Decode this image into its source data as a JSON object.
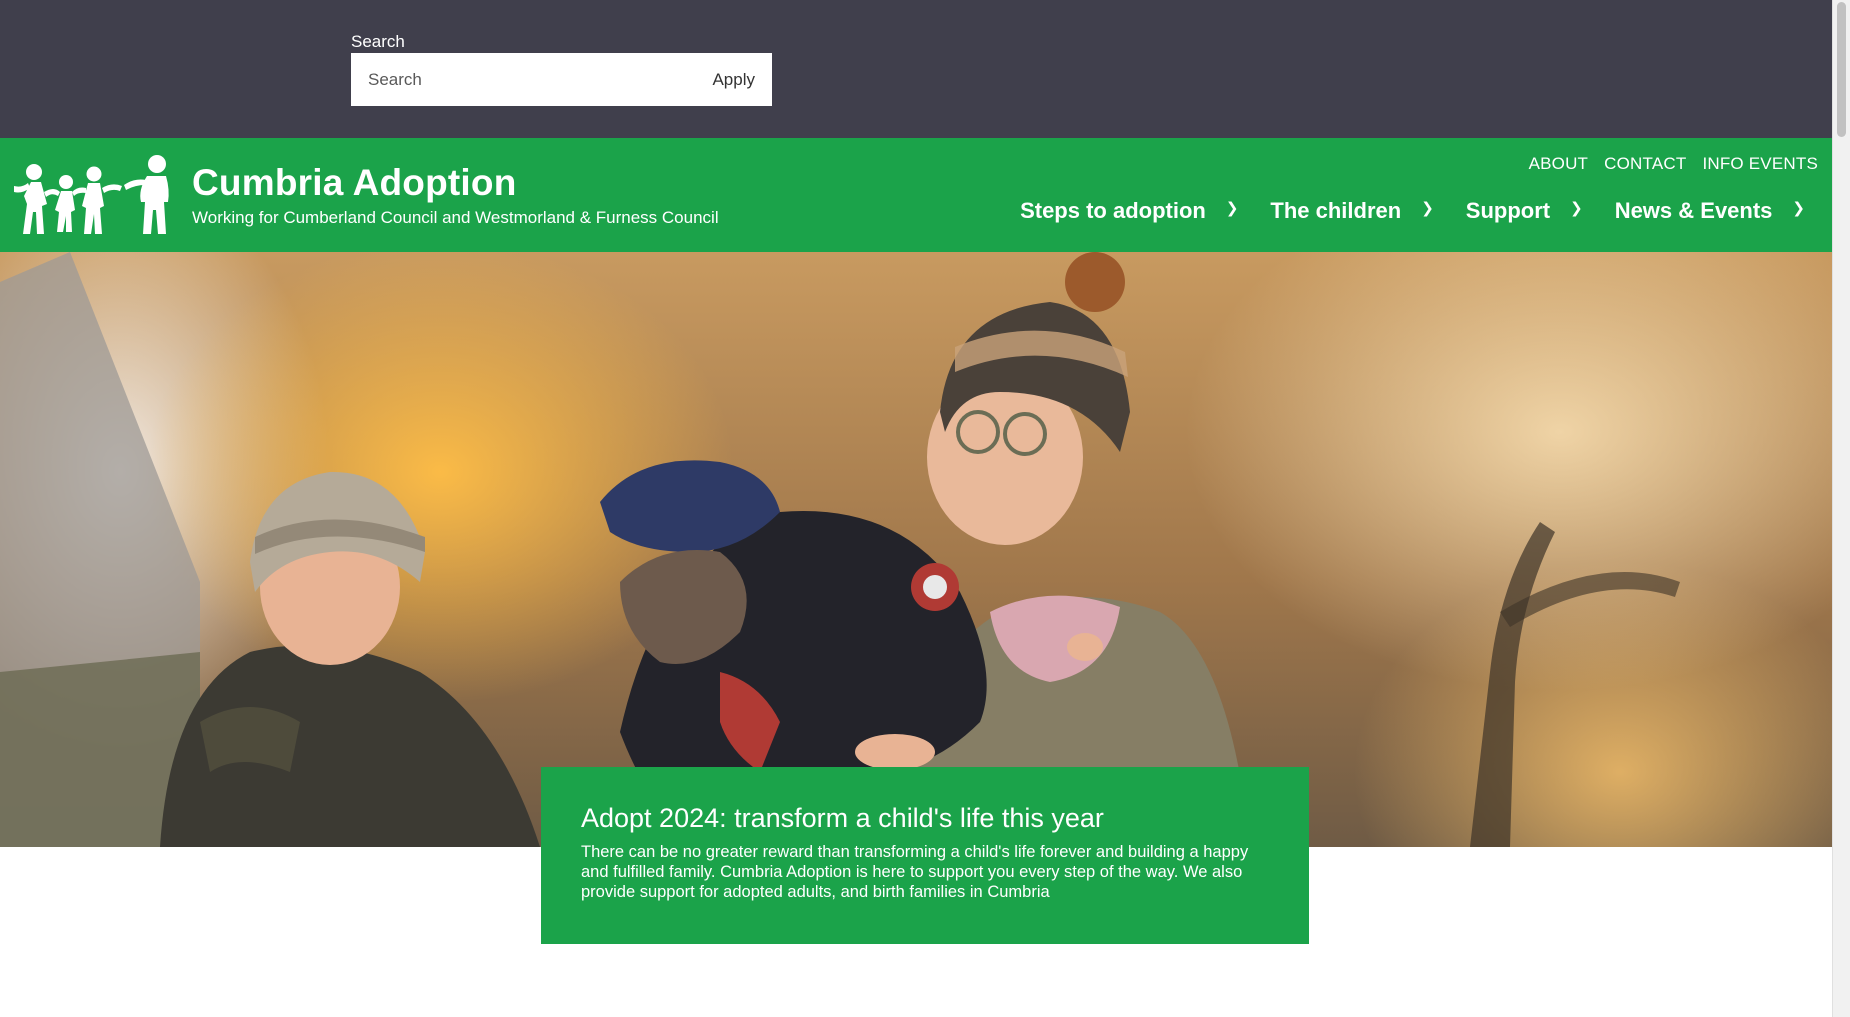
{
  "search": {
    "label": "Search",
    "placeholder": "Search",
    "value": "",
    "apply_label": "Apply"
  },
  "header": {
    "title": "Cumbria Adoption",
    "subtitle": "Working for Cumberland Council and Westmorland & Furness Council",
    "logo_icon": "family-figures-logo-icon",
    "background": "#1ba34a"
  },
  "utility_nav": [
    {
      "label": "ABOUT"
    },
    {
      "label": "CONTACT"
    },
    {
      "label": "INFO EVENTS"
    }
  ],
  "main_nav": [
    {
      "label": "Steps to adoption",
      "icon": "chevron-right-icon"
    },
    {
      "label": "The children",
      "icon": "chevron-right-icon"
    },
    {
      "label": "Support",
      "icon": "chevron-right-icon"
    },
    {
      "label": "News & Events",
      "icon": "chevron-right-icon"
    }
  ],
  "hero": {
    "image": "photo-two-women-holding-child-in-winter-sunlight"
  },
  "callout": {
    "heading": "Adopt 2024: transform a child's life this year",
    "body": "There can be no greater reward than transforming a child's life forever and building a happy and fulfilled family. Cumbria Adoption is here to support you every step of the way. We also provide support for adopted adults, and birth families in Cumbria"
  },
  "colors": {
    "search_strip": "#403f4c",
    "brand_green": "#1ba34a",
    "text_light": "#ffffff"
  }
}
